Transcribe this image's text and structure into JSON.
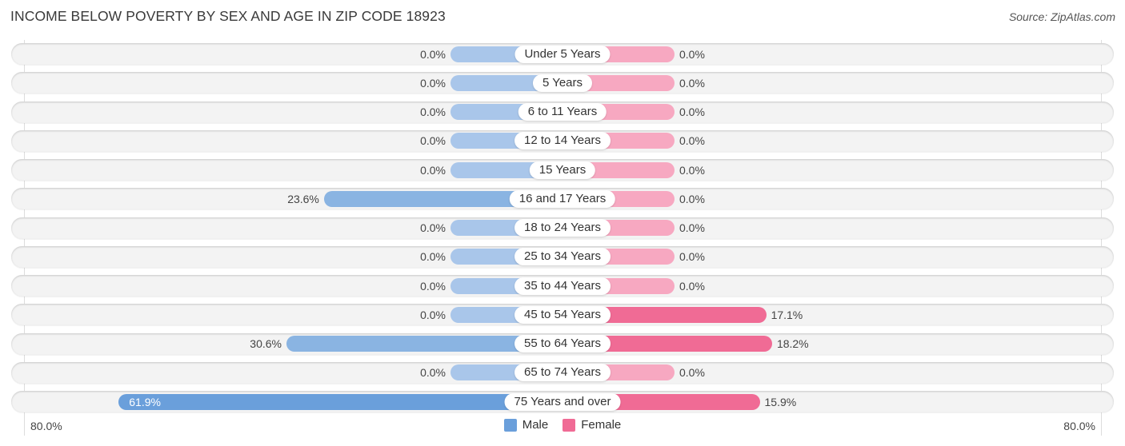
{
  "header": {
    "title": "INCOME BELOW POVERTY BY SEX AND AGE IN ZIP CODE 18923",
    "source": "Source: ZipAtlas.com"
  },
  "colors": {
    "male_light": "#a9c6ea",
    "male_strong": "#6a9fdb",
    "female_light": "#f7a8c1",
    "female_strong": "#f06b95"
  },
  "chart_data": {
    "type": "bar",
    "orientation": "horizontal-diverging",
    "title": "INCOME BELOW POVERTY BY SEX AND AGE IN ZIP CODE 18923",
    "categories": [
      "Under 5 Years",
      "5 Years",
      "6 to 11 Years",
      "12 to 14 Years",
      "15 Years",
      "16 and 17 Years",
      "18 to 24 Years",
      "25 to 34 Years",
      "35 to 44 Years",
      "45 to 54 Years",
      "55 to 64 Years",
      "65 to 74 Years",
      "75 Years and over"
    ],
    "series": [
      {
        "name": "Male",
        "values": [
          0.0,
          0.0,
          0.0,
          0.0,
          0.0,
          23.6,
          0.0,
          0.0,
          0.0,
          0.0,
          30.6,
          0.0,
          61.9
        ],
        "labels": [
          "0.0%",
          "0.0%",
          "0.0%",
          "0.0%",
          "0.0%",
          "23.6%",
          "0.0%",
          "0.0%",
          "0.0%",
          "0.0%",
          "30.6%",
          "0.0%",
          "61.9%"
        ]
      },
      {
        "name": "Female",
        "values": [
          0.0,
          0.0,
          0.0,
          0.0,
          0.0,
          0.0,
          0.0,
          0.0,
          0.0,
          17.1,
          18.2,
          0.0,
          15.9
        ],
        "labels": [
          "0.0%",
          "0.0%",
          "0.0%",
          "0.0%",
          "0.0%",
          "0.0%",
          "0.0%",
          "0.0%",
          "0.0%",
          "17.1%",
          "18.2%",
          "0.0%",
          "15.9%"
        ]
      }
    ],
    "xlim": [
      -80,
      80
    ],
    "axis_left_label": "80.0%",
    "axis_right_label": "80.0%",
    "legend": [
      "Male",
      "Female"
    ],
    "legend_position": "bottom-center"
  }
}
